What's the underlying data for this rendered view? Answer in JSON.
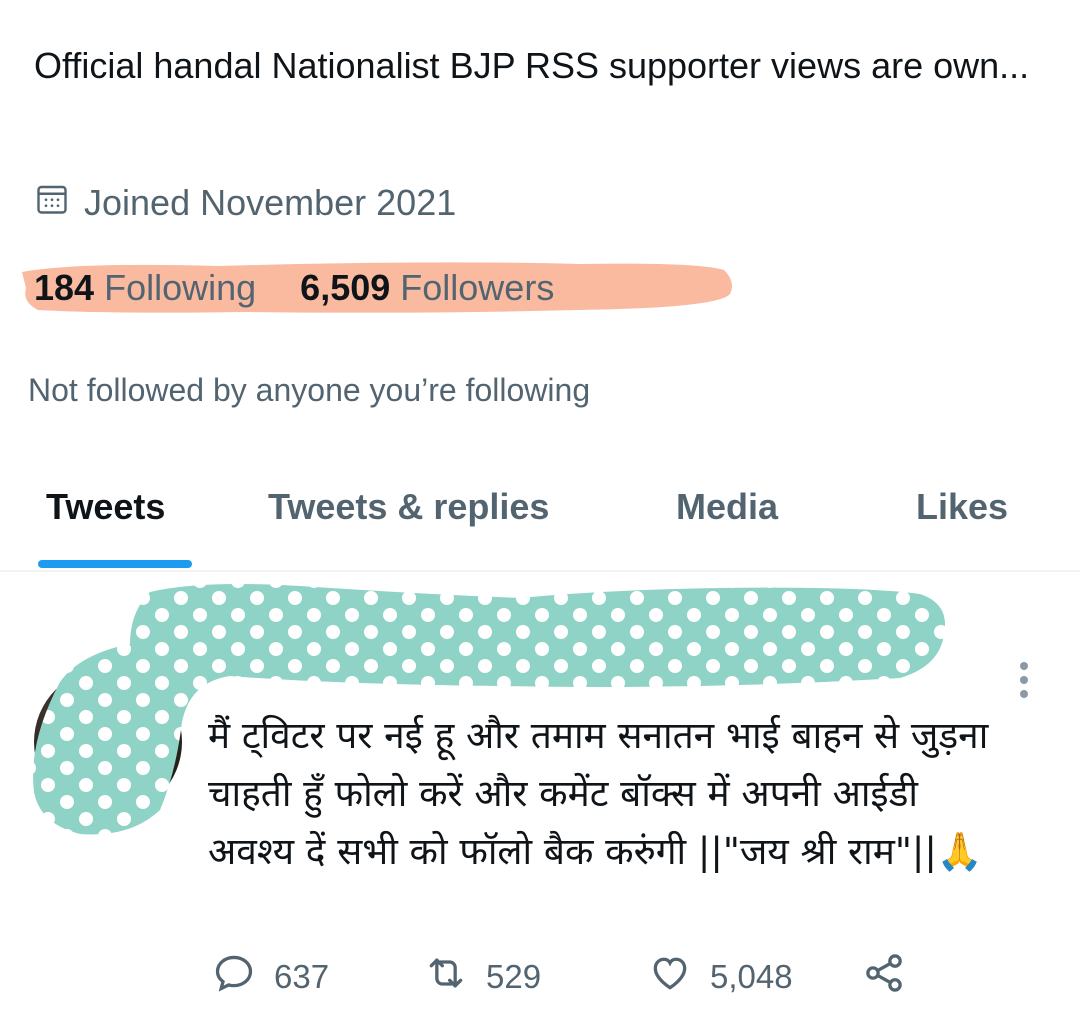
{
  "profile": {
    "bio": "Official handal Nationalist BJP RSS supporter views are own...",
    "joined": "Joined November 2021",
    "following_count": "184",
    "following_label": "Following",
    "followers_count": "6,509",
    "followers_label": "Followers",
    "not_followed": "Not followed by anyone you’re following"
  },
  "tabs": [
    {
      "label": "Tweets",
      "active": true
    },
    {
      "label": "Tweets & replies"
    },
    {
      "label": "Media"
    },
    {
      "label": "Likes"
    }
  ],
  "tweet": {
    "text": "मैं ट्विटर पर नई हू और तमाम सनातन भाई बाहन से जुड़ना चाहती हुँ फोलो करें और कमेंट बॉक्स में अपनी आईडी अवश्य दें सभी को फॉलो बैक करुंगी ||\"जय श्री राम\"||🙏",
    "replies": "637",
    "retweets": "529",
    "likes": "5,048"
  },
  "colors": {
    "accent": "#1d9bf0",
    "highlight": "#f9b396",
    "mask": "#8fd3c6",
    "secondary_text": "#536471"
  },
  "icons": [
    "calendar-icon",
    "more-icon",
    "reply-icon",
    "retweet-icon",
    "like-icon",
    "share-icon"
  ]
}
